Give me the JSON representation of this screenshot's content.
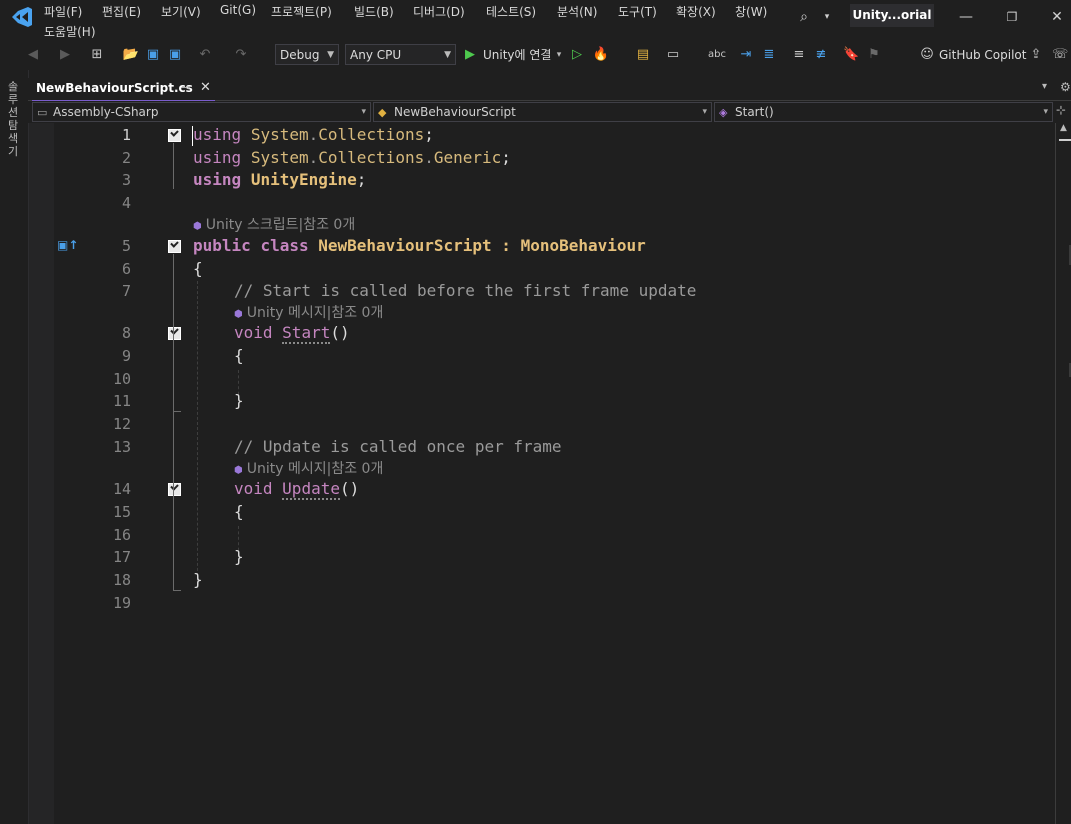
{
  "menu": {
    "items": [
      "파일(F)",
      "편집(E)",
      "보기(V)",
      "Git(G)",
      "프로젝트(P)",
      "빌드(B)",
      "디버그(D)",
      "테스트(S)",
      "분석(N)",
      "도구(T)",
      "확장(X)",
      "창(W)"
    ],
    "help": "도움말(H)",
    "title_badge": "Unity...orial"
  },
  "toolbar": {
    "config": "Debug",
    "platform": "Any CPU",
    "attach_label": "Unity에 연결",
    "copilot_label": "GitHub Copilot"
  },
  "sidebar": {
    "explorer_tab": "솔루션 탐색기"
  },
  "tab": {
    "filename": "NewBehaviourScript.cs",
    "pin_icon": "⊸",
    "close_icon": "✕"
  },
  "nav": {
    "project": "Assembly-CSharp",
    "type": "NewBehaviourScript",
    "member": "Start()"
  },
  "editor": {
    "line_numbers": [
      "1",
      "2",
      "3",
      "4",
      "5",
      "6",
      "7",
      "8",
      "9",
      "10",
      "11",
      "12",
      "13",
      "14",
      "15",
      "16",
      "17",
      "18",
      "19"
    ],
    "current_line": 1,
    "lens_class": "Unity 스크립트|참조 0개",
    "lens_start": "Unity 메시지|참조 0개",
    "lens_update": "Unity 메시지|참조 0개",
    "code": {
      "l1_kw": "using",
      "l1_ns1": "System",
      "l1_dot": ".",
      "l1_ns2": "Collections",
      "l1_end": ";",
      "l2_kw": "using",
      "l2_ns1": "System",
      "l2_ns2": "Collections",
      "l2_ns3": "Generic",
      "l2_end": ";",
      "l3_kw": "using",
      "l3_ns": "UnityEngine",
      "l3_end": ";",
      "l5_kw1": "public",
      "l5_kw2": "class",
      "l5_cls": "NewBehaviourScript",
      "l5_colon": ":",
      "l5_base": "MonoBehaviour",
      "l6": "{",
      "l7": "// Start is called before the first frame update",
      "l8_kw": "void",
      "l8_name": "Start",
      "l8_paren": "()",
      "l9": "{",
      "l11": "}",
      "l13": "// Update is called once per frame",
      "l14_kw": "void",
      "l14_name": "Update",
      "l14_paren": "()",
      "l15": "{",
      "l17": "}",
      "l18": "}"
    }
  },
  "colors": {
    "keyword": "#c586c0",
    "namespace": "#d7ba7d",
    "class": "#e5c07b",
    "comment": "#9a9a9a",
    "background": "#1f1f1f"
  }
}
